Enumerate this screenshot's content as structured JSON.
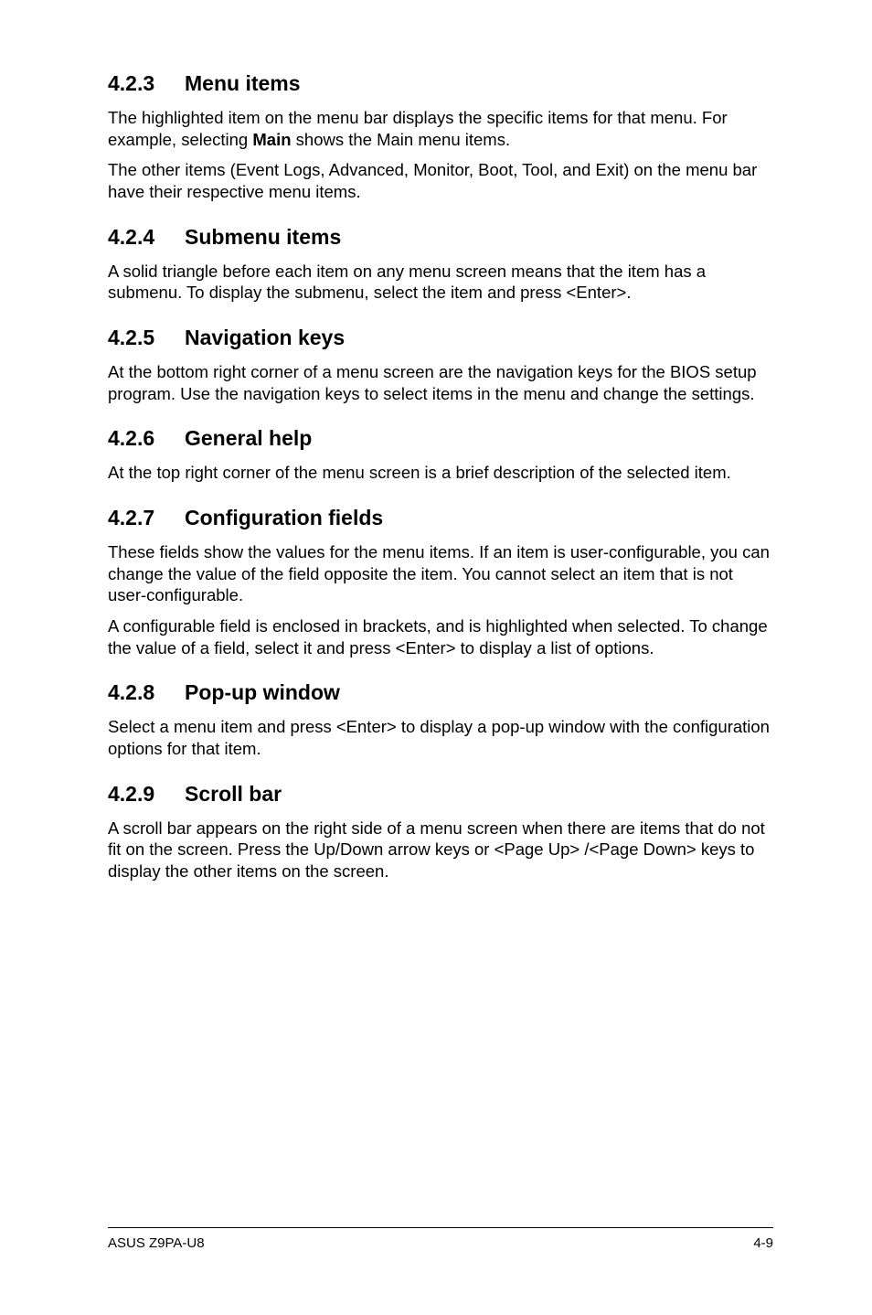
{
  "sections": {
    "s1": {
      "num": "4.2.3",
      "title": "Menu items",
      "p1a": "The highlighted item on the menu bar displays the specific items for that menu. For example, selecting ",
      "p1b": "Main",
      "p1c": " shows the Main menu items.",
      "p2": "The other items (Event Logs, Advanced, Monitor, Boot, Tool, and Exit) on the menu bar have their respective menu items."
    },
    "s2": {
      "num": "4.2.4",
      "title": "Submenu items",
      "p1": "A solid triangle before each item on any menu screen means that the item has a submenu. To display the submenu, select the item and press <Enter>."
    },
    "s3": {
      "num": "4.2.5",
      "title": "Navigation keys",
      "p1": "At the bottom right corner of a menu screen are the navigation keys for the BIOS setup program. Use the navigation keys to select items in the menu and change the settings."
    },
    "s4": {
      "num": "4.2.6",
      "title": "General help",
      "p1": "At the top right corner of the menu screen is a brief description of the selected item."
    },
    "s5": {
      "num": "4.2.7",
      "title": "Configuration fields",
      "p1": "These fields show the values for the menu items. If an item is user-configurable, you can change the value of the field opposite the item. You cannot select an item that is not user-configurable.",
      "p2": "A configurable field is enclosed in brackets, and is highlighted when selected. To change the value of a field, select it and press <Enter> to display a list of options."
    },
    "s6": {
      "num": "4.2.8",
      "title": "Pop-up window",
      "p1": "Select a menu item and press <Enter> to display a pop-up window with the configuration options for that item."
    },
    "s7": {
      "num": "4.2.9",
      "title": "Scroll bar",
      "p1": "A scroll bar appears on the right side of a menu screen when there are items that do not fit on the screen. Press the Up/Down arrow keys or <Page Up> /<Page Down> keys to display the other items on the screen."
    }
  },
  "footer": {
    "left": "ASUS Z9PA-U8",
    "right": "4-9"
  }
}
